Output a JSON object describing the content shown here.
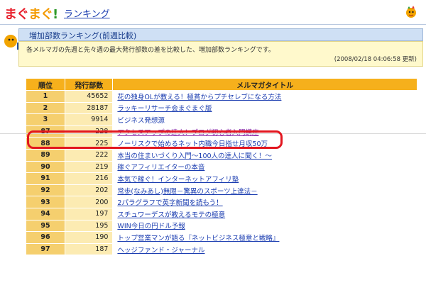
{
  "header": {
    "logo": {
      "p1": "まぐ",
      "p2": "まぐ",
      "p3": "!",
      "p4": ""
    },
    "link_label": "ランキング"
  },
  "section": {
    "title": "増加部数ランキング(前週比較)",
    "description": "各メルマガの先週と先々週の最大発行部数の差を比較した、増加部数ランキングです。",
    "updated": "(2008/02/18 04:06:58 更新)"
  },
  "table": {
    "headers": [
      "順位",
      "発行部数",
      "メルマガタイトル"
    ],
    "rows": [
      {
        "rank": "1",
        "count": "45652",
        "title": "花の独身OLが教える！極貧からプチセレブになる方法"
      },
      {
        "rank": "2",
        "count": "28187",
        "title": "ラッキーリサーチ会まぐまぐ版"
      },
      {
        "rank": "3",
        "count": "9914",
        "title": "ビジネス発想源"
      },
      {
        "rank": "87",
        "count": "228",
        "title": "アクセスアップの達人！ブログ初心者入門講座"
      },
      {
        "rank": "88",
        "count": "225",
        "title": "ノーリスクで始めるネット内職今日指せ月収50万"
      },
      {
        "rank": "89",
        "count": "222",
        "title": "本当の住まいづくり入門～100人の達人に聞く！～"
      },
      {
        "rank": "90",
        "count": "219",
        "title": "稼ぐアフィリエイターの本音"
      },
      {
        "rank": "91",
        "count": "216",
        "title": "本気で稼ぐ！インターネットアフィリ塾"
      },
      {
        "rank": "92",
        "count": "202",
        "title": "常歩(なみあし)無限－驚異のスポーツ上達法－"
      },
      {
        "rank": "93",
        "count": "200",
        "title": "2パラグラフで英字新聞を読もう！"
      },
      {
        "rank": "94",
        "count": "197",
        "title": "スチュワーデスが教えるモテの極意"
      },
      {
        "rank": "95",
        "count": "195",
        "title": "WIN今日の円ドル予報"
      },
      {
        "rank": "96",
        "count": "190",
        "title": "トップ営業マンが語る『ネットビジネス極意と戦略』"
      },
      {
        "rank": "97",
        "count": "187",
        "title": "ヘッジファンド・ジャーナル"
      }
    ]
  },
  "colors": {
    "header_bg": "#f6b01c",
    "rank_bg": "#f5cf6e",
    "count_bg": "#fcebb2",
    "link": "#1a3cb0",
    "highlight": "#e2161f"
  },
  "icons": [
    "mascot-icon",
    "ranking-icon"
  ]
}
